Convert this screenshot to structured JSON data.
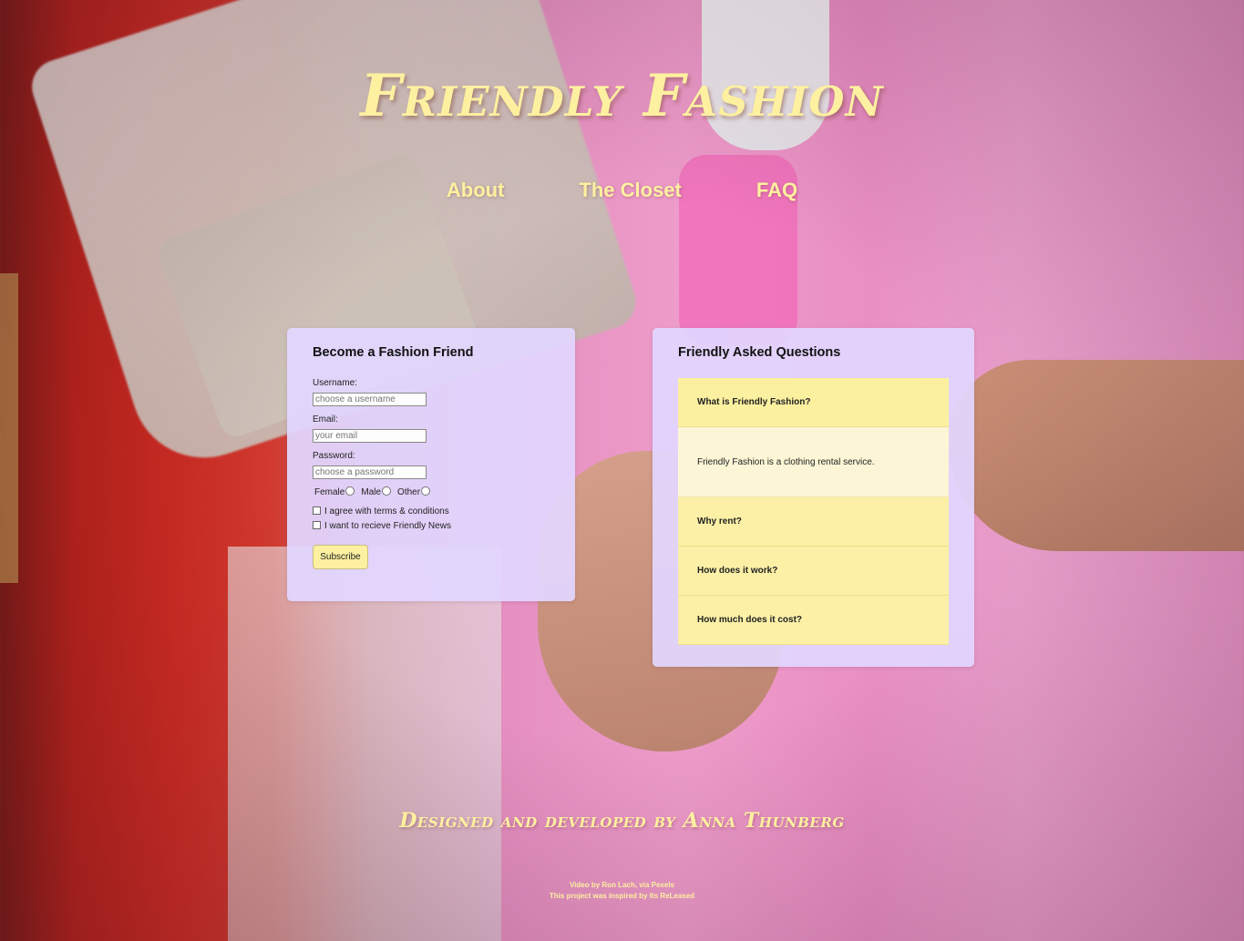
{
  "header": {
    "title": "Friendly Fashion"
  },
  "nav": {
    "items": [
      "About",
      "The Closet",
      "FAQ"
    ]
  },
  "signup": {
    "heading": "Become a Fashion Friend",
    "username_label": "Username:",
    "username_placeholder": "choose a username",
    "email_label": "Email:",
    "email_placeholder": "your email",
    "password_label": "Password:",
    "password_placeholder": "choose a password",
    "gender_options": [
      "Female",
      "Male",
      "Other"
    ],
    "terms_label": "I agree with terms & conditions",
    "news_label": "I want to recieve Friendly News",
    "subscribe_label": "Subscribe"
  },
  "faq": {
    "heading": "Friendly Asked Questions",
    "questions": [
      "What is Friendly Fashion?",
      "Why rent?",
      "How does it work?",
      "How much does it cost?"
    ],
    "open_answer": "Friendly Fashion is a clothing rental service."
  },
  "footer": {
    "credit": "Designed and developed by Anna Thunberg",
    "video_credit": "Video by Ron Lach, via Pexels",
    "inspiration": "This project was inspired by Its ReLeased"
  },
  "colors": {
    "accent_yellow": "#fdf0a0",
    "card_lavender": "#e2d6ff",
    "faq_item": "#fbf0a6",
    "faq_answer": "#fcf6d6"
  }
}
